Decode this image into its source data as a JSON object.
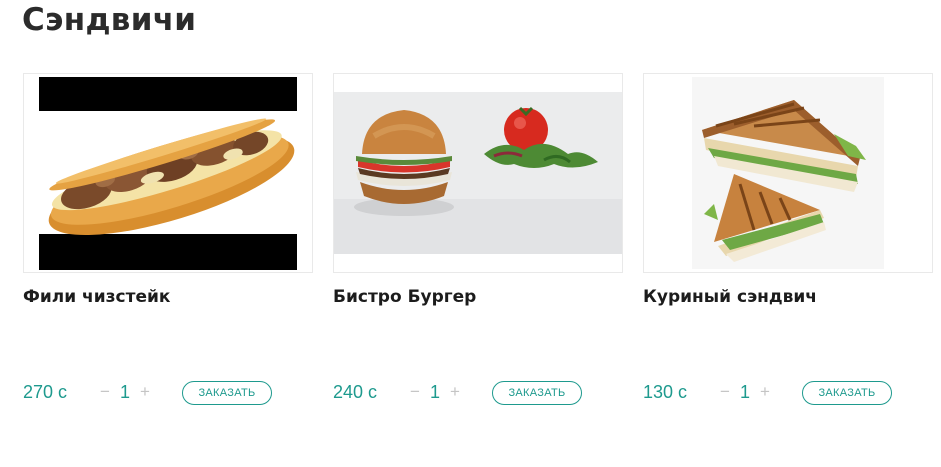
{
  "section": {
    "title": "Сэндвичи"
  },
  "accent_color": "#1e9a8e",
  "products": [
    {
      "image_icon": "cheesesteak-image",
      "name": "Фили чизстейк",
      "price": "270 с",
      "qty_minus": "−",
      "qty": "1",
      "qty_plus": "+",
      "order_label": "ЗАКАЗАТЬ"
    },
    {
      "image_icon": "burger-image",
      "name": "Бистро Бургер",
      "price": "240 с",
      "qty_minus": "−",
      "qty": "1",
      "qty_plus": "+",
      "order_label": "ЗАКАЗАТЬ"
    },
    {
      "image_icon": "chicken-sandwich-image",
      "name": "Куриный сэндвич",
      "price": "130 с",
      "qty_minus": "−",
      "qty": "1",
      "qty_plus": "+",
      "order_label": "ЗАКАЗАТЬ"
    }
  ]
}
